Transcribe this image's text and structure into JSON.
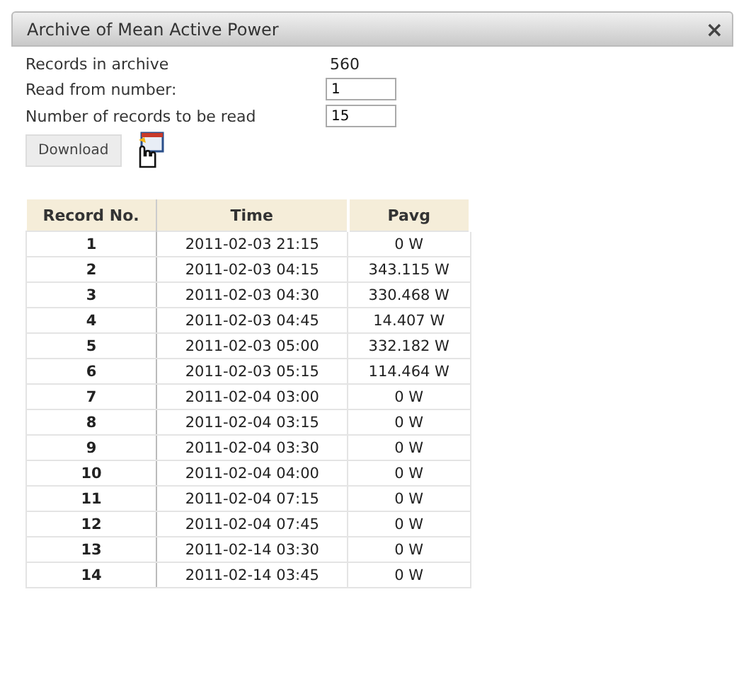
{
  "window": {
    "title": "Archive of Mean Active Power",
    "close": "×"
  },
  "form": [
    {
      "label": "Records in archive",
      "kind": "text",
      "value": "560"
    },
    {
      "label": "Read from number:",
      "kind": "input",
      "value": "1"
    },
    {
      "label": "Number of records to be read",
      "kind": "input",
      "value": "15"
    }
  ],
  "button": "Download",
  "table": {
    "columns": [
      "Record No.",
      "Time",
      "Pavg"
    ],
    "rows": [
      [
        "1",
        "2011-02-03 21:15",
        "0 W"
      ],
      [
        "2",
        "2011-02-03 04:15",
        "343.115 W"
      ],
      [
        "3",
        "2011-02-03 04:30",
        "330.468 W"
      ],
      [
        "4",
        "2011-02-03 04:45",
        "14.407 W"
      ],
      [
        "5",
        "2011-02-03 05:00",
        "332.182 W"
      ],
      [
        "6",
        "2011-02-03 05:15",
        "114.464 W"
      ],
      [
        "7",
        "2011-02-04 03:00",
        "0 W"
      ],
      [
        "8",
        "2011-02-04 03:15",
        "0 W"
      ],
      [
        "9",
        "2011-02-04 03:30",
        "0 W"
      ],
      [
        "10",
        "2011-02-04 04:00",
        "0 W"
      ],
      [
        "11",
        "2011-02-04 07:15",
        "0 W"
      ],
      [
        "12",
        "2011-02-04 07:45",
        "0 W"
      ],
      [
        "13",
        "2011-02-14 03:30",
        "0 W"
      ],
      [
        "14",
        "2011-02-14 03:45",
        "0 W"
      ]
    ]
  }
}
